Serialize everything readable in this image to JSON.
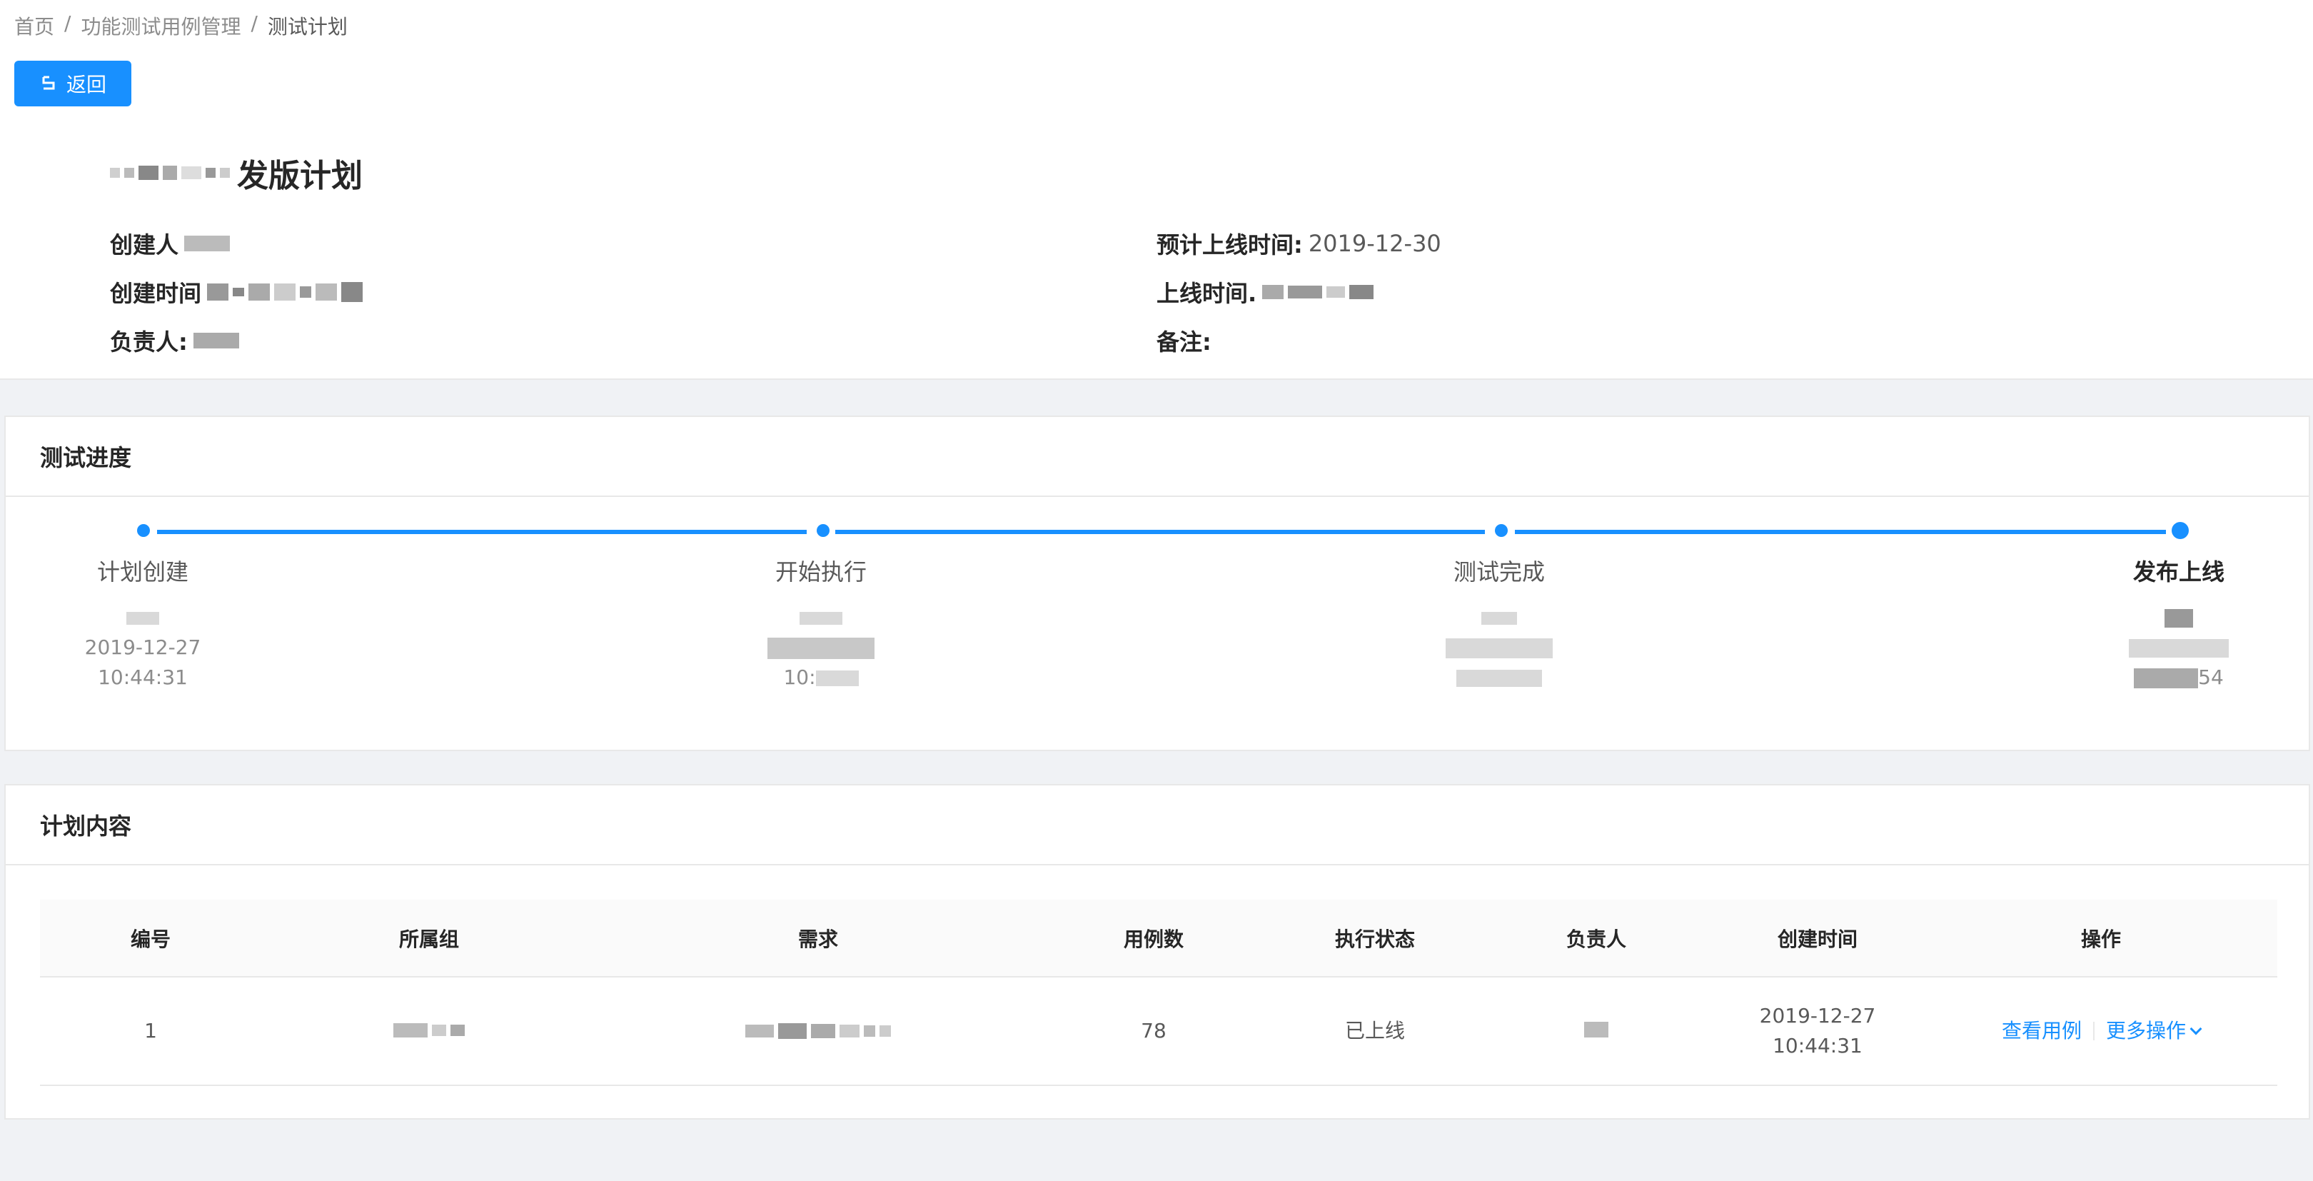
{
  "breadcrumb": {
    "items": [
      "首页",
      "功能测试用例管理",
      "测试计划"
    ],
    "separator": "/"
  },
  "header": {
    "back_label": "返回",
    "plan_title": "发版计划",
    "meta": {
      "creator_label": "创建人",
      "create_time_label": "创建时间",
      "owner_label": "负责人:",
      "expected_online_label": "预计上线时间:",
      "expected_online_value": "2019-12-30",
      "online_time_label": "上线时间.",
      "remark_label": "备注:"
    }
  },
  "progress": {
    "title": "测试进度",
    "steps": [
      {
        "title": "计划创建",
        "date": "2019-12-27",
        "time": "10:44:31",
        "active": false
      },
      {
        "title": "开始执行",
        "date": "",
        "time": "10:",
        "active": false
      },
      {
        "title": "测试完成",
        "date": "",
        "time": "",
        "active": false
      },
      {
        "title": "发布上线",
        "date": "",
        "time": "54",
        "active": true
      }
    ]
  },
  "content": {
    "title": "计划内容",
    "columns": [
      "编号",
      "所属组",
      "需求",
      "用例数",
      "执行状态",
      "负责人",
      "创建时间",
      "操作"
    ],
    "rows": [
      {
        "id": "1",
        "case_count": "78",
        "status": "已上线",
        "created_date": "2019-12-27",
        "created_time": "10:44:31",
        "view_label": "查看用例",
        "more_label": "更多操作"
      }
    ]
  },
  "colors": {
    "primary": "#1890ff",
    "background": "#f0f2f5"
  }
}
